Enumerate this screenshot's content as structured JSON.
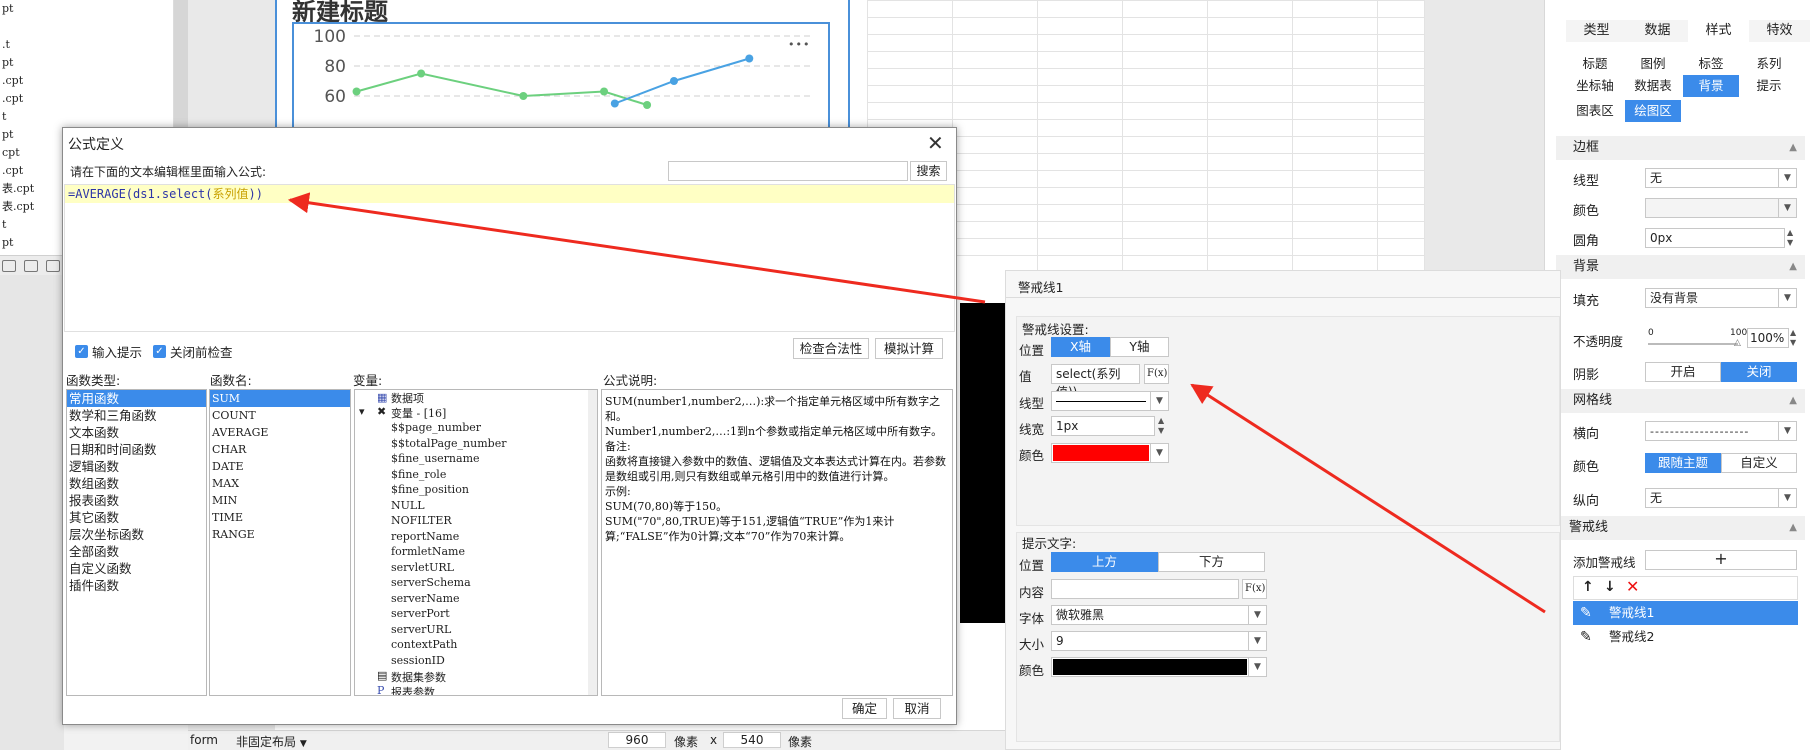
{
  "file_tree": {
    "items": [
      "pt",
      "",
      ".t",
      "pt",
      ".cpt",
      ".cpt",
      "t",
      "pt",
      "cpt",
      ".cpt",
      "表.cpt",
      "表.cpt",
      "t",
      "pt"
    ]
  },
  "chart": {
    "title": "新建标题",
    "menu_dots": "•••",
    "chart_data": {
      "type": "line",
      "y_ticks": [
        "100",
        "80",
        "60"
      ],
      "ylim": [
        50,
        100
      ],
      "series": [
        {
          "color": "#6cd07e",
          "points": [
            [
              0.12,
              63
            ],
            [
              0.24,
              75
            ],
            [
              0.43,
              60
            ],
            [
              0.58,
              63
            ],
            [
              0.66,
              54
            ]
          ]
        },
        {
          "color": "#49a2e3",
          "points": [
            [
              0.6,
              55
            ],
            [
              0.71,
              70
            ],
            [
              0.85,
              85
            ]
          ]
        }
      ]
    }
  },
  "statusbar": {
    "form": "form",
    "layout": "非固定布局",
    "width": "960",
    "unit1": "像素",
    "x": "x",
    "height": "540",
    "unit2": "像素"
  },
  "right_panel": {
    "tabs": [
      "类型",
      "数据",
      "样式",
      "特效"
    ],
    "subtabs_row1": [
      "标题",
      "图例",
      "标签",
      "系列"
    ],
    "subtabs_row2": [
      "坐标轴",
      "数据表",
      "背景",
      "提示"
    ],
    "subtabs_row3": [
      "图表区",
      "绘图区"
    ],
    "border_section": "边框",
    "line_type_label": "线型",
    "line_type_value": "无",
    "color_label": "颜色",
    "radius_label": "圆角",
    "radius_value": "0px",
    "background_section": "背景",
    "fill_label": "填充",
    "fill_value": "没有背景",
    "opacity_label": "不透明度",
    "opacity_min": "0",
    "opacity_max": "100",
    "opacity_value": "100%",
    "shadow_label": "阴影",
    "shadow_on": "开启",
    "shadow_off": "关闭",
    "gridline_section": "网格线",
    "horizontal_label": "横向",
    "grid_color_label": "颜色",
    "follow_theme": "跟随主题",
    "custom": "自定义",
    "vertical_label": "纵向",
    "vertical_value": "无",
    "warning_section": "警戒线",
    "add_warning_label": "添加警戒线",
    "add_symbol": "+",
    "warning_lines": [
      "警戒线1",
      "警戒线2"
    ]
  },
  "formula_dialog": {
    "title": "公式定义",
    "hint": "请在下面的文本编辑框里面输入公式:",
    "search_button": "搜索",
    "formula_fn": "=AVERAGE(ds1.select(",
    "formula_arg": "系列值",
    "formula_end": "))",
    "input_hint_label": "输入提示",
    "check_before_close_label": "关闭前检查",
    "check_validity_button": "检查合法性",
    "simulate_button": "模拟计算",
    "headers": {
      "types": "函数类型:",
      "names": "函数名:",
      "vars": "变量:",
      "desc": "公式说明:"
    },
    "function_types": [
      "常用函数",
      "数学和三角函数",
      "文本函数",
      "日期和时间函数",
      "逻辑函数",
      "数组函数",
      "报表函数",
      "其它函数",
      "层次坐标函数",
      "全部函数",
      "自定义函数",
      "插件函数"
    ],
    "function_names": [
      "SUM",
      "COUNT",
      "AVERAGE",
      "CHAR",
      "DATE",
      "MAX",
      "MIN",
      "TIME",
      "RANGE"
    ],
    "variables": {
      "data_items": "数据项",
      "var_group": "变量 - [16]",
      "vars": [
        "$$page_number",
        "$$totalPage_number",
        "$fine_username",
        "$fine_role",
        "$fine_position",
        "NULL",
        "NOFILTER",
        "reportName",
        "formletName",
        "servletURL",
        "serverSchema",
        "serverName",
        "serverPort",
        "serverURL",
        "contextPath",
        "sessionID"
      ],
      "dataset_params": "数据集参数",
      "report_params": "报表参数"
    },
    "description": [
      "SUM(number1,number2,…):求一个指定单元格区域中所有数字之和。",
      "Number1,number2,…:1到n个参数或指定单元格区域中所有数字。",
      "备注:",
      "函数将直接键入参数中的数值、逻辑值及文本表达式计算在内。若参数是数组或引用,则只有数组或单元格引用中的数值进行计算。",
      "示例:",
      "SUM(70,80)等于150。",
      "SUM(\"70\",80,TRUE)等于151,逻辑值“TRUE”作为1来计算;“FALSE”作为0计算;文本“70”作为70来计算。"
    ],
    "ok_button": "确定",
    "cancel_button": "取消"
  },
  "warning_dialog": {
    "title": "警戒线1",
    "settings_label": "警戒线设置:",
    "position_label": "位置",
    "x_axis": "X轴",
    "y_axis": "Y轴",
    "value_label": "值",
    "value": "select(系列值))",
    "fx": "F(x)",
    "line_type_label": "线型",
    "line_width_label": "线宽",
    "line_width_value": "1px",
    "color_label": "颜色",
    "line_color": "#ff0000",
    "tip_label": "提示文字:",
    "tip_position_label": "位置",
    "above": "上方",
    "below": "下方",
    "content_label": "内容",
    "font_label": "字体",
    "font_value": "微软雅黑",
    "size_label": "大小",
    "size_value": "9",
    "tip_color_label": "颜色",
    "tip_color": "#000000"
  },
  "colors": {
    "accent": "#3b8bea",
    "annotation_arrow": "#ee2a1f"
  }
}
